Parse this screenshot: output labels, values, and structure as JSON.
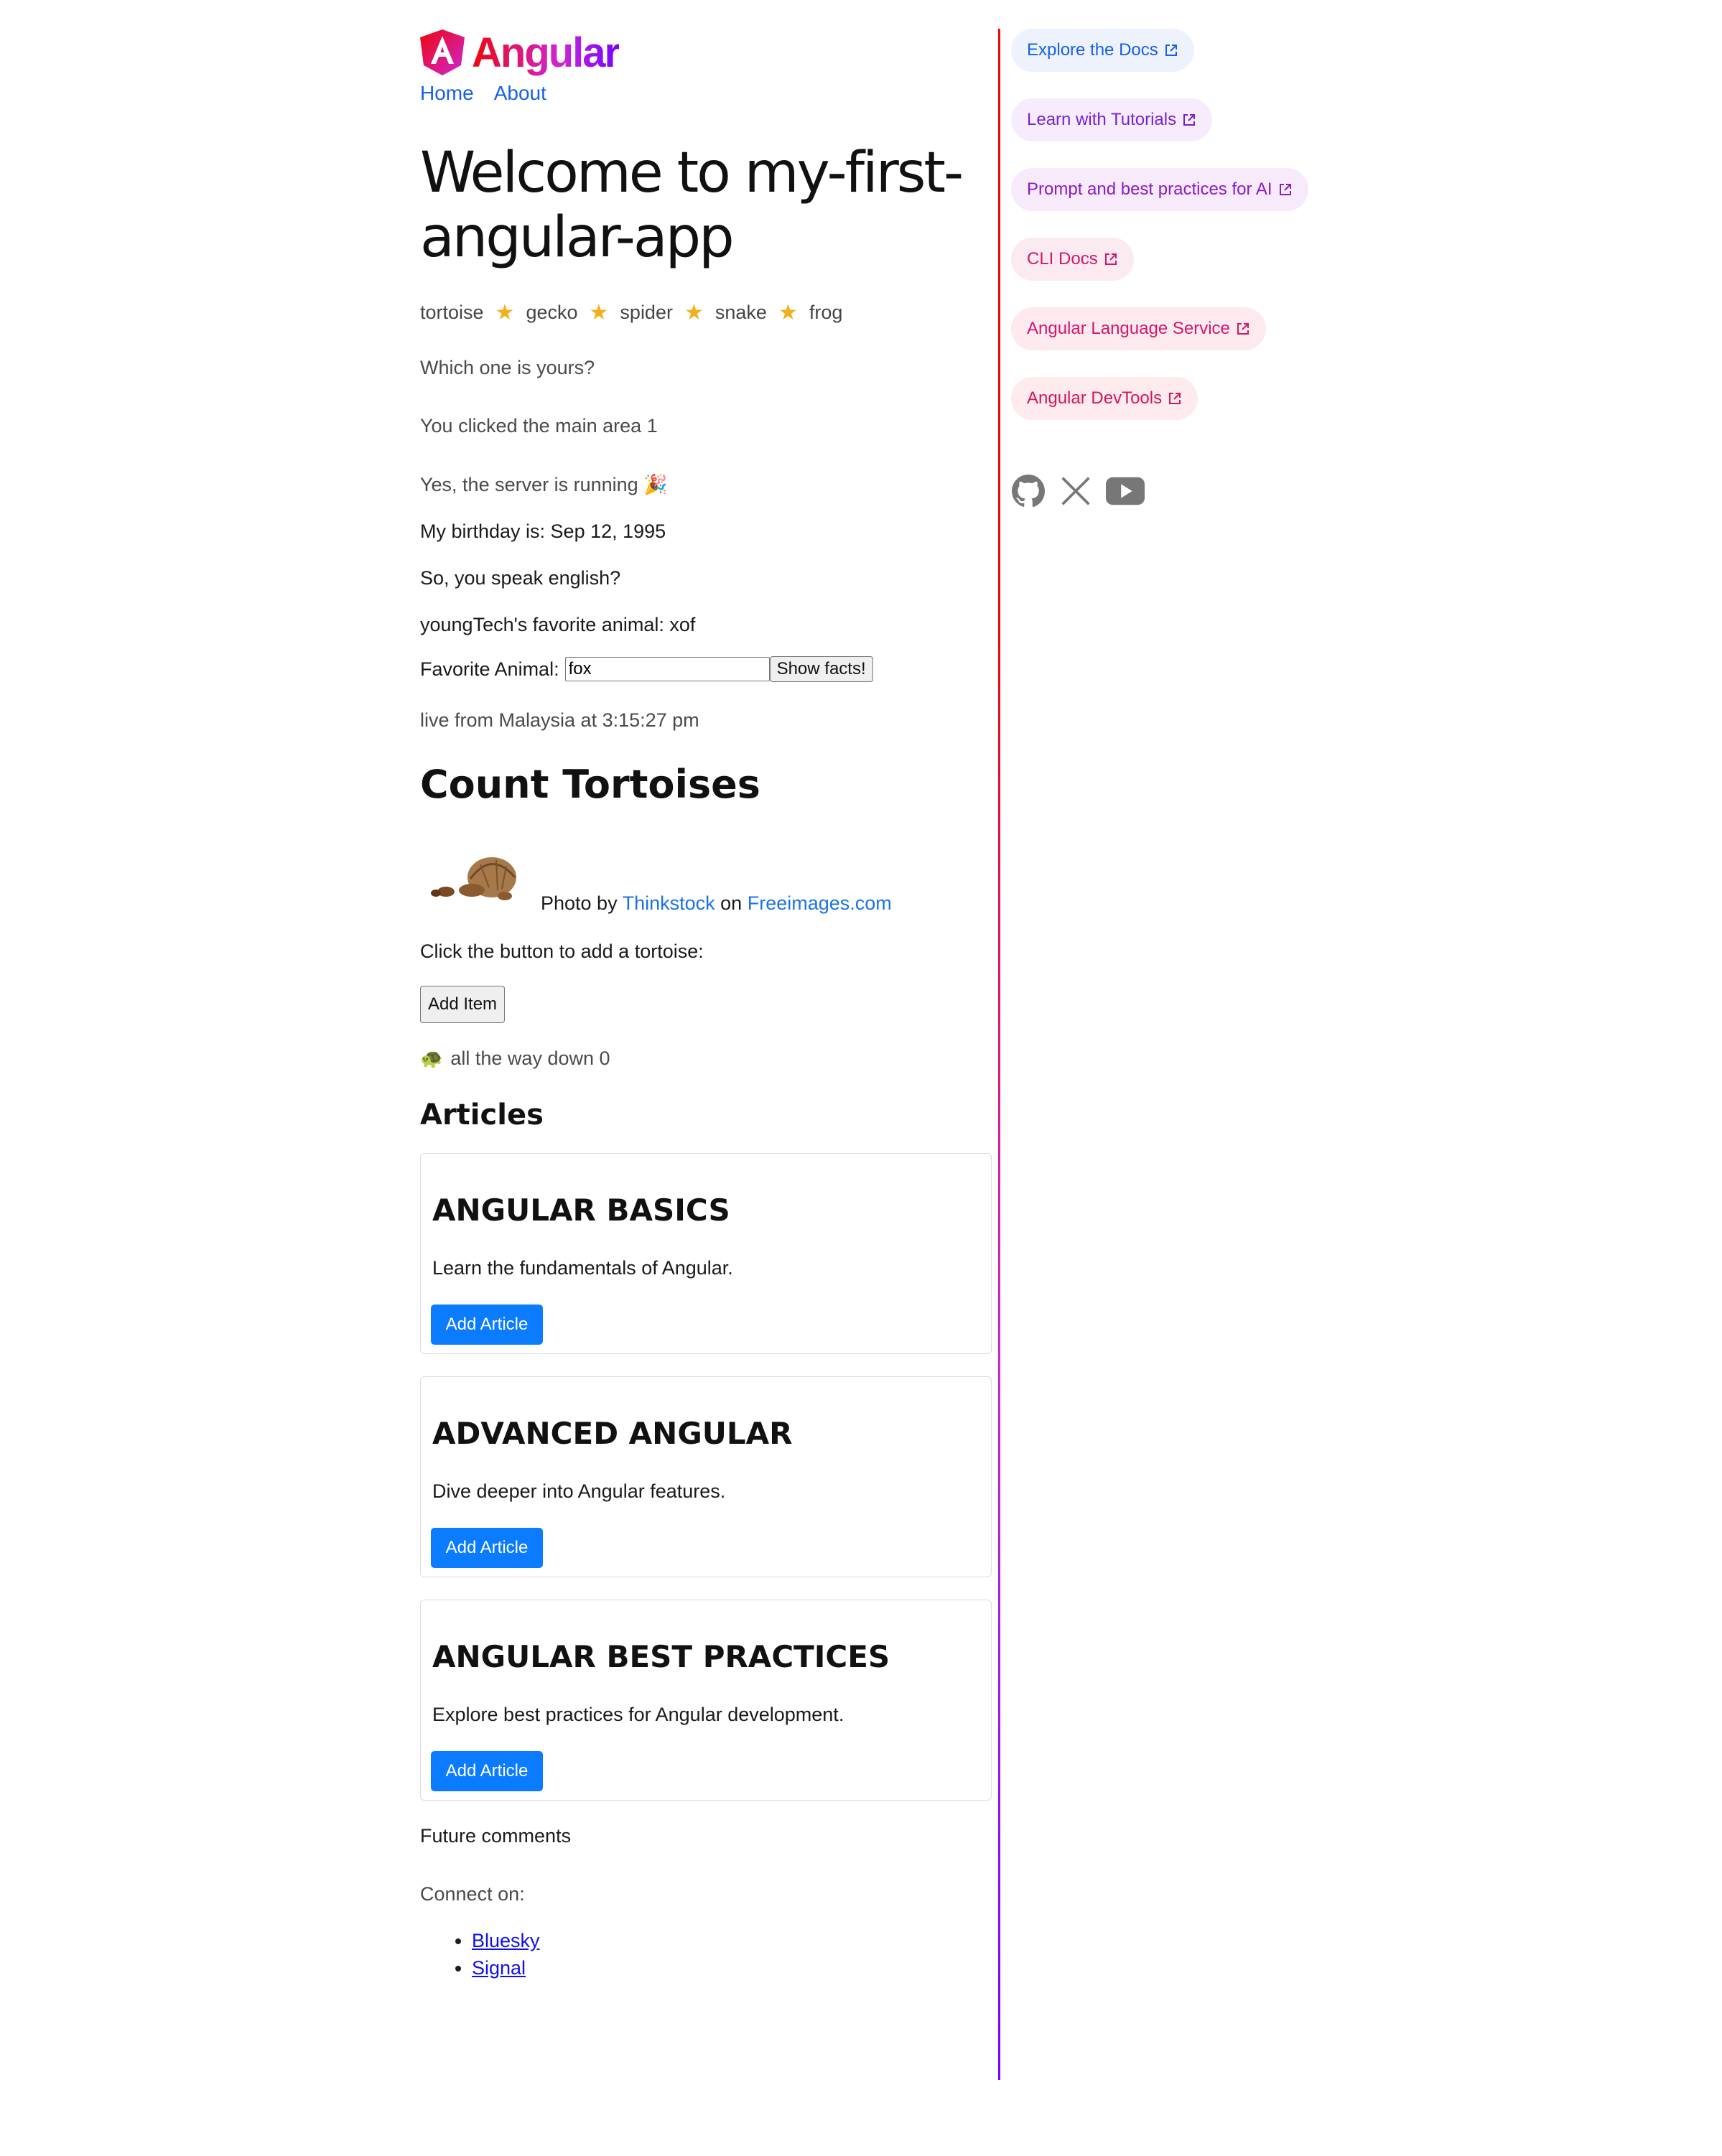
{
  "header": {
    "logo_text": "Angular",
    "nav": [
      "Home",
      "About"
    ]
  },
  "main": {
    "title": "Welcome to my-first-angular-app",
    "animals": [
      "tortoise",
      "gecko",
      "spider",
      "snake",
      "frog"
    ],
    "question": "Which one is yours?",
    "clicked": "You clicked the main area 1",
    "server": "Yes, the server is running 🎉",
    "birthday": "My birthday is: Sep 12, 1995",
    "language": "So, you speak english?",
    "favorite_animal_text": "youngTech's favorite animal: xof",
    "favorite_label": "Favorite Animal:",
    "favorite_value": "fox",
    "show_facts": "Show facts!",
    "live": "live from Malaysia at 3:15:27 pm",
    "count_title": "Count Tortoises",
    "credit": {
      "prefix": "Photo by",
      "author": "Thinkstock",
      "middle": "on",
      "site": "Freeimages.com"
    },
    "add_prompt": "Click the button to add a tortoise:",
    "add_item": "Add Item",
    "turtle_emoji": "🐢",
    "all_way_down": "all the way down 0",
    "articles_title": "Articles",
    "articles": [
      {
        "title": "ANGULAR BASICS",
        "desc": "Learn the fundamentals of Angular.",
        "button": "Add Article"
      },
      {
        "title": "ADVANCED ANGULAR",
        "desc": "Dive deeper into Angular features.",
        "button": "Add Article"
      },
      {
        "title": "ANGULAR BEST PRACTICES",
        "desc": "Explore best practices for Angular development.",
        "button": "Add Article"
      }
    ],
    "future_comments": "Future comments",
    "connect": "Connect on:",
    "connect_links": [
      "Bluesky",
      "Signal"
    ]
  },
  "sidebar": {
    "pills": [
      {
        "label": "Explore the Docs",
        "color": "#1660e6",
        "bg": "#eef2fd"
      },
      {
        "label": "Learn with Tutorials",
        "color": "#7a1fd0",
        "bg": "#f6ecfb"
      },
      {
        "label": "Prompt and best practices for AI",
        "color": "#8a1bc7",
        "bg": "#f7ebfb"
      },
      {
        "label": "CLI Docs",
        "color": "#d3176b",
        "bg": "#fceaf1"
      },
      {
        "label": "Angular Language Service",
        "color": "#d3176b",
        "bg": "#fdeaef"
      },
      {
        "label": "Angular DevTools",
        "color": "#d3175a",
        "bg": "#fdebee"
      }
    ],
    "social": [
      "github-icon",
      "x-icon",
      "youtube-icon"
    ]
  }
}
